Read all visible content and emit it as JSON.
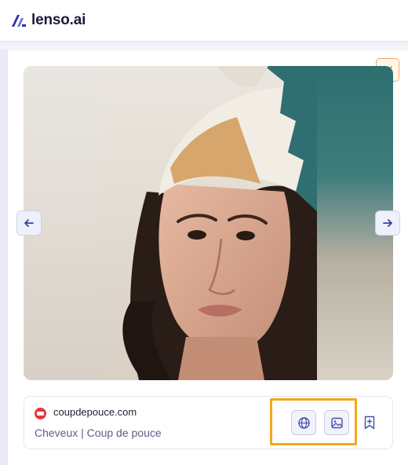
{
  "header": {
    "logo_text": "lenso.ai",
    "logo_icon": "lenso-logo-icon"
  },
  "viewer": {
    "close_icon": "close-icon",
    "prev_icon": "arrow-left-icon",
    "next_icon": "arrow-right-icon",
    "image_subject": "portrait photo"
  },
  "result": {
    "favicon_icon": "site-favicon-icon",
    "domain": "coupdepouce.com",
    "title": "Cheveux | Coup de pouce",
    "actions": {
      "globe_icon": "globe-icon",
      "image_icon": "image-icon",
      "bookmark_icon": "bookmark-add-icon"
    }
  },
  "colors": {
    "accent": "#4a4ea8",
    "highlight": "#f2a91a",
    "close_border": "#f0a85a"
  }
}
